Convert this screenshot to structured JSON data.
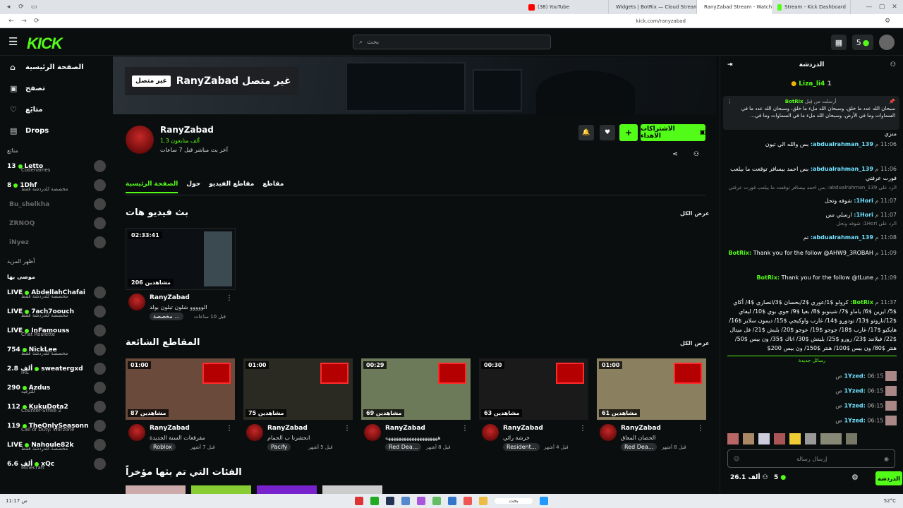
{
  "browser": {
    "tabs": [
      {
        "label": "(38) YouTube",
        "color": "#ff0000"
      },
      {
        "label": "Widgets | BotRix — Cloud Streaming",
        "color": "#222"
      },
      {
        "label": "RanyZabad Stream - Watch Live",
        "color": "#53fc18"
      },
      {
        "label": "Stream - Kick Dashboard",
        "color": "#53fc18"
      }
    ],
    "url": "kick.com/ranyzabad"
  },
  "header": {
    "logo": "KICK",
    "search_placeholder": "بحث",
    "kick_count": "5"
  },
  "sidebar": {
    "nav": [
      {
        "label": "الصفحة الرئيسية",
        "icon": "home-icon"
      },
      {
        "label": "تصفح",
        "icon": "browse-icon"
      },
      {
        "label": "متابَع",
        "icon": "heart-icon"
      },
      {
        "label": "Drops",
        "icon": "drops-icon"
      }
    ],
    "following_title": "متابَع",
    "following": [
      {
        "count": "13",
        "name": "Letto",
        "game": "Codenames",
        "live": true
      },
      {
        "count": "8",
        "name": "1Dhf",
        "game": "مخصصة للدردشة فقط",
        "live": true
      },
      {
        "count": "",
        "name": "Bu_shelkha",
        "game": "",
        "live": false
      },
      {
        "count": "",
        "name": "ZRNOQ",
        "game": "",
        "live": false
      },
      {
        "count": "",
        "name": "iNyez",
        "game": "",
        "live": false
      }
    ],
    "show_more": "أظهر المزيد",
    "recommended_title": "موصى بها",
    "recommended": [
      {
        "count": "LIVE",
        "name": "AbdellahChafai",
        "game": "مخصصة للدردشة فقط"
      },
      {
        "count": "LIVE",
        "name": "7ach7oouch",
        "game": "مخصصة للدردشة فقط"
      },
      {
        "count": "LIVE",
        "name": "InFamouss",
        "game": "Chat Roulette"
      },
      {
        "count": "754",
        "name": "NickLee",
        "game": "مخصصة للدردشة فقط"
      },
      {
        "count": "2.8 ألف",
        "name": "sweatergxd",
        "game": "IRL"
      },
      {
        "count": "290",
        "name": "Azdus",
        "game": "للترفيه"
      },
      {
        "count": "112",
        "name": "KukuDota2",
        "game": "Counter-Strike 2"
      },
      {
        "count": "119",
        "name": "TheOnlySeasonn",
        "game": "Call of Duty: Warzone"
      },
      {
        "count": "LIVE",
        "name": "Nahoule82k",
        "game": "مخصصة للدردشة فقط"
      },
      {
        "count": "6.6 ألف",
        "name": "xQc",
        "game": "Minecraft"
      }
    ]
  },
  "channel": {
    "banner_text": "RanyZabad غير متصل",
    "offline_badge": "غير متصل",
    "name": "RanyZabad",
    "followers": "1.3 ألف متابعون",
    "last_live": "آخر بث مباشر قبل 7 ساعات",
    "subscribe": "الاشتراكات الاهداء",
    "follow": "+",
    "tabs": [
      "الصفحة الرئيسية",
      "حول",
      "مقاطع الفيديو",
      "مقاطع"
    ]
  },
  "vods": {
    "title": "بث فيديو هات",
    "show_all": "عرض الكل",
    "items": [
      {
        "duration": "02:33:41",
        "views": "206 مشاهدين",
        "channel": "RanyZabad",
        "title": "الووووو شلون تبلون بولد",
        "meta": "قبل 10 ساعات",
        "category": "مخصصة ..."
      }
    ]
  },
  "clips": {
    "title": "المقاطع الشائعة",
    "show_all": "عرض الكل",
    "items": [
      {
        "duration": "01:00",
        "views": "87 مشاهدين",
        "channel": "RanyZabad",
        "title": "مفرقعات السنة الجديدة",
        "meta": "قبل 7 أشهر",
        "category": "Roblox"
      },
      {
        "duration": "01:00",
        "views": "75 مشاهدين",
        "channel": "RanyZabad",
        "title": "انحشرنا ب الحمام",
        "meta": "قبل 5 أشهر",
        "category": "Pacify"
      },
      {
        "duration": "00:29",
        "views": "69 مشاهدين",
        "channel": "RanyZabad",
        "title": "ههههههههههههههههههههه",
        "meta": "قبل 8 أشهر",
        "category": "Red Dea..."
      },
      {
        "duration": "00:30",
        "views": "63 مشاهدين",
        "channel": "RanyZabad",
        "title": "خرشة رائي",
        "meta": "قبل 4 أشهر",
        "category": "Resident..."
      },
      {
        "duration": "01:00",
        "views": "61 مشاهدين",
        "channel": "RanyZabad",
        "title": "الحصان المعاق",
        "meta": "قبل 8 أشهر",
        "category": "Red Dea..."
      }
    ]
  },
  "recent_categories_title": "الفئات التي تم بثها مؤخراً",
  "chat": {
    "title": "الدردشة",
    "gifter": "Liza_li4",
    "gifter_count": "1",
    "pinned_by": "أرسلت من قِبل",
    "pinned_user": "BotRix",
    "pinned_text": "سبحان الله عدد ما خلق، وسبحان الله ملء ما خلق، وسبحان الله عدد ما في السماوات وما في الأرض، وسبحان الله ملء ما في السماوات وما في...",
    "messages": [
      {
        "time": "",
        "user": "",
        "text": "منزي"
      },
      {
        "time": "11:06 م",
        "user": "abdualrahman_139:",
        "text": "بس والله الي تيون"
      },
      {
        "time": "11:06 م",
        "user": "abdualrahman_139:",
        "text": "بس احمد بيسافر توقعت ما بيلعب فورت عرفتي"
      },
      {
        "time": "11:07 م",
        "user": "1Hori:",
        "text": "شوفه وتحل"
      },
      {
        "time": "11:07 م",
        "user": "1Hori:",
        "text": "ارسلي نس"
      },
      {
        "time": "11:08 م",
        "user": "abdualrahman_139:",
        "text": "تم"
      },
      {
        "time": "11:09 م",
        "user": "BotRix:",
        "text": "Thank you for the follow @AHW9_3ROBAH"
      },
      {
        "time": "11:09 م",
        "user": "BotRix:",
        "text": "Thank you for the follow @tLune"
      },
      {
        "time": "11:37 م",
        "user": "BotRix:",
        "text": "كرولو $1/عوري $2/بحسان $3/انصاري $4/ أكاي $5/ ايرين $6/ ياماو $7/ شينوبو $8/ بغيا $9/ جوي بوي $10/ ليفاي $12/ناروتو $13/ تودورو $14/ غارب واوكيجي $15/ ديمون سلاير $16/ هايكيو $17/ غارب $18/ جوجو $19/ عوجو $20/ بلبش $21/ فل ميتال $22/ فيلانند $23/ زورو $25/ بليتش $30/ اتاك $35/ ون بيس $50/ هنتر $80/ ون بيس $100/ هنتر $150/ ون بيس 200$"
      }
    ],
    "replies": [
      "الرد على abdualrahman_139: بس احمد بيسافر توقعت ما بيلعب فورت عرفتي",
      "الرد على 1Hori: شوفه وتحل"
    ],
    "new_messages": "رسائل جديدة",
    "yzed_messages": [
      {
        "time": "06:15 ص",
        "user": "1Yzed:"
      },
      {
        "time": "06:15 ص",
        "user": "1Yzed:"
      },
      {
        "time": "06:15 ص",
        "user": "1Yzed:"
      },
      {
        "time": "06:15 ص",
        "user": "1Yzed:"
      }
    ],
    "input_placeholder": "إرسال رسالة",
    "viewers": "26.1 ألف",
    "kicks": "5",
    "send_label": "الدردشة"
  },
  "taskbar": {
    "search": "بحث",
    "weather": "52°C",
    "time": "11:17 ص"
  }
}
